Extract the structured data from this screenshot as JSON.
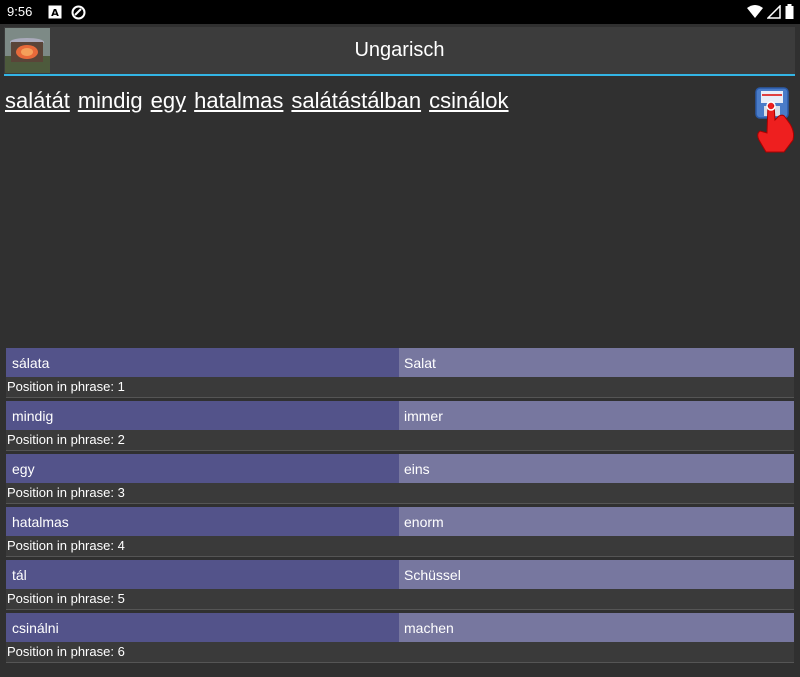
{
  "status": {
    "time": "9:56"
  },
  "app": {
    "title": "Ungarisch"
  },
  "phrase_words": [
    "salátát",
    "mindig",
    "egy",
    "hatalmas",
    "salátástálban",
    "csinálok"
  ],
  "position_label": "Position in phrase:",
  "words": [
    {
      "hu": "sálata",
      "de": "Salat",
      "pos": "1"
    },
    {
      "hu": "mindig",
      "de": "immer",
      "pos": "2"
    },
    {
      "hu": "egy",
      "de": "eins",
      "pos": "3"
    },
    {
      "hu": "hatalmas",
      "de": "enorm",
      "pos": "4"
    },
    {
      "hu": "tál",
      "de": "Schüssel",
      "pos": "5"
    },
    {
      "hu": "csinálni",
      "de": "machen",
      "pos": "6"
    }
  ],
  "colors": {
    "accent": "#33b5e5",
    "hu_cell": "#53538a",
    "de_cell": "#77779f"
  },
  "icons": [
    "notification-a-icon",
    "sync-icon",
    "wifi-icon",
    "signal-icon",
    "battery-icon",
    "save-icon",
    "tap-hand-icon"
  ]
}
